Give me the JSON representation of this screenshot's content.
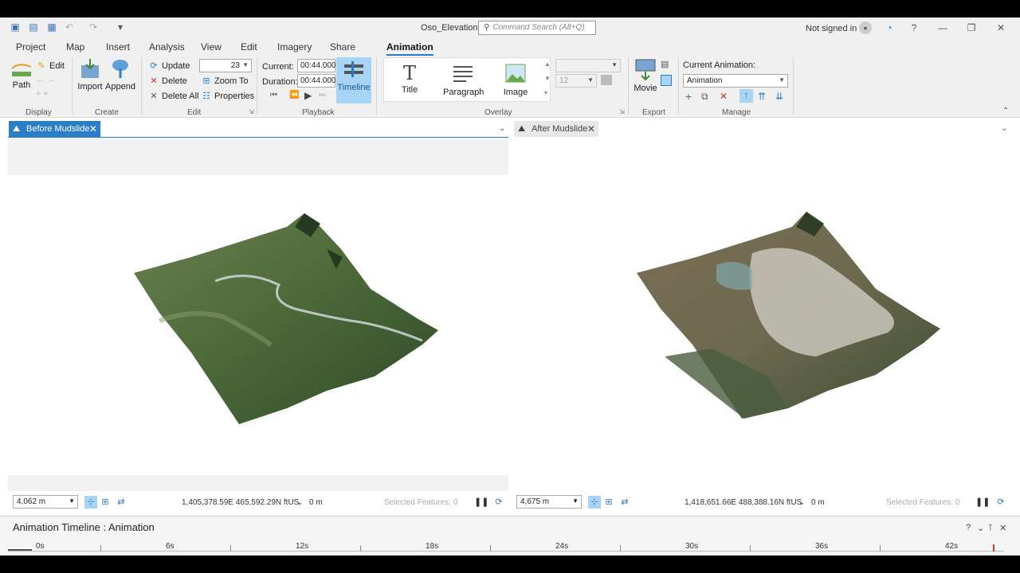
{
  "window": {
    "title": "Oso_Elevation",
    "search_placeholder": "Command Search (Alt+Q)",
    "signin": "Not signed in"
  },
  "tabs": [
    "Project",
    "Map",
    "Insert",
    "Analysis",
    "View",
    "Edit",
    "Imagery",
    "Share",
    "Animation"
  ],
  "active_tab": "Animation",
  "ribbon": {
    "display": {
      "path": "Path",
      "edit": "Edit",
      "label": "Display"
    },
    "create": {
      "import": "Import",
      "append": "Append",
      "label": "Create"
    },
    "edit": {
      "update": "Update",
      "delete": "Delete",
      "delete_all": "Delete All",
      "zoom_to": "Zoom To",
      "properties": "Properties",
      "keyframe_number": "23",
      "label": "Edit"
    },
    "playback": {
      "current_label": "Current:",
      "current_value": "00:44.000",
      "duration_label": "Duration:",
      "duration_value": "00:44.000",
      "timeline": "Timeline",
      "label": "Playback"
    },
    "overlay": {
      "title": "Title",
      "paragraph": "Paragraph",
      "image": "Image",
      "font_size": "12",
      "label": "Overlay"
    },
    "export": {
      "movie": "Movie",
      "label": "Export"
    },
    "manage": {
      "current_label": "Current Animation:",
      "current_value": "Animation",
      "label": "Manage"
    }
  },
  "views": {
    "left": {
      "tab": "Before Mudslide",
      "scale": "4,062 m",
      "coords": "1,405,378.59E 465,592.29N ftUS",
      "elev": "0 m",
      "selected": "Selected Features: 0"
    },
    "right": {
      "tab": "After Mudslide",
      "scale": "4,675 m",
      "coords": "1,418,651.66E 488,388.16N ftUS",
      "elev": "0 m",
      "selected": "Selected Features: 0"
    }
  },
  "timeline": {
    "title": "Animation Timeline : Animation",
    "ticks": [
      "0s",
      "6s",
      "12s",
      "18s",
      "24s",
      "30s",
      "36s",
      "42s"
    ]
  },
  "colors": {
    "accent": "#2a7ec7",
    "timeline_btn": "#a7d3f5"
  }
}
